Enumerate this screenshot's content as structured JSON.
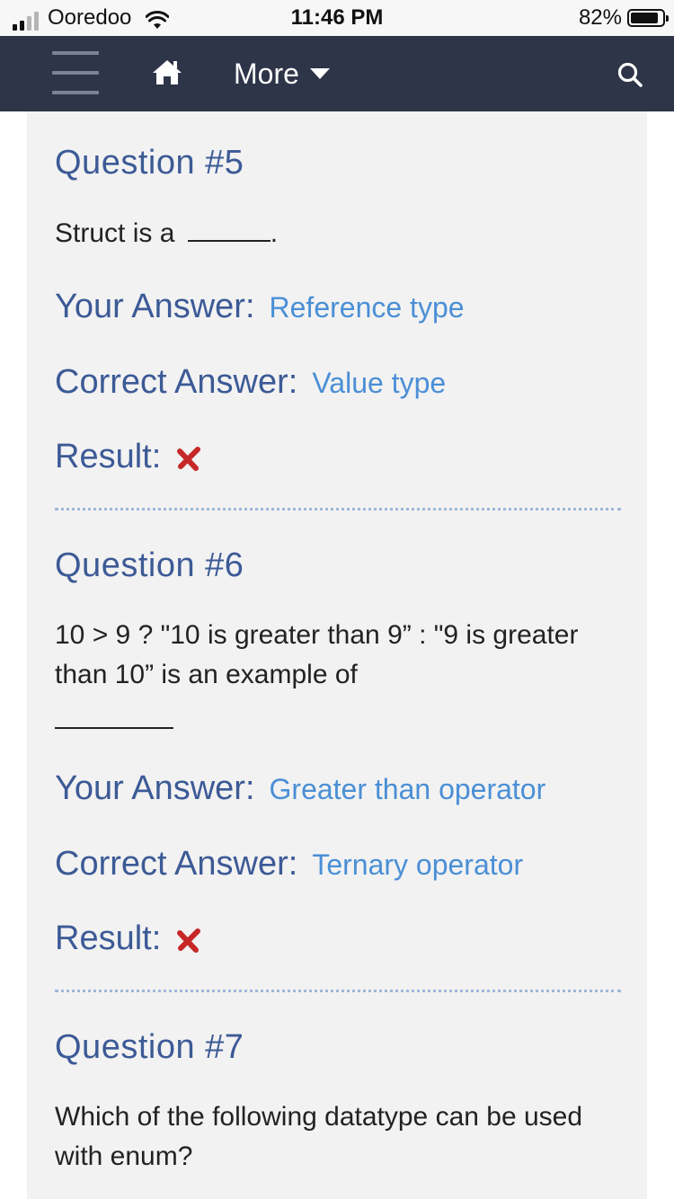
{
  "status_bar": {
    "carrier": "Ooredoo",
    "time": "11:46 PM",
    "battery": "82%"
  },
  "nav": {
    "menu_icon": "hamburger-icon",
    "home_icon": "home-icon",
    "more_label": "More",
    "search_icon": "search-icon",
    "bg_color": "#2e3548"
  },
  "questions": [
    {
      "heading": "Question #5",
      "text": "Struct is a",
      "blank_suffix": ".",
      "your_answer_label": "Your Answer:",
      "your_answer": "Reference type",
      "correct_answer_label": "Correct Answer:",
      "correct_answer": "Value type",
      "result_label": "Result:",
      "result_icon": "wrong-x-icon"
    },
    {
      "heading": "Question #6",
      "text": "10 > 9 ? \"10 is greater than 9” : \"9 is greater than 10” is an example of",
      "your_answer_label": "Your Answer:",
      "your_answer": "Greater than operator",
      "correct_answer_label": "Correct Answer:",
      "correct_answer": "Ternary operator",
      "result_label": "Result:",
      "result_icon": "wrong-x-icon"
    },
    {
      "heading": "Question #7",
      "text": "Which of the following datatype can be used with enum?"
    }
  ],
  "colors": {
    "heading": "#3c5a96",
    "answer_value": "#4a8fd6",
    "wrong_icon": "#c62828"
  }
}
